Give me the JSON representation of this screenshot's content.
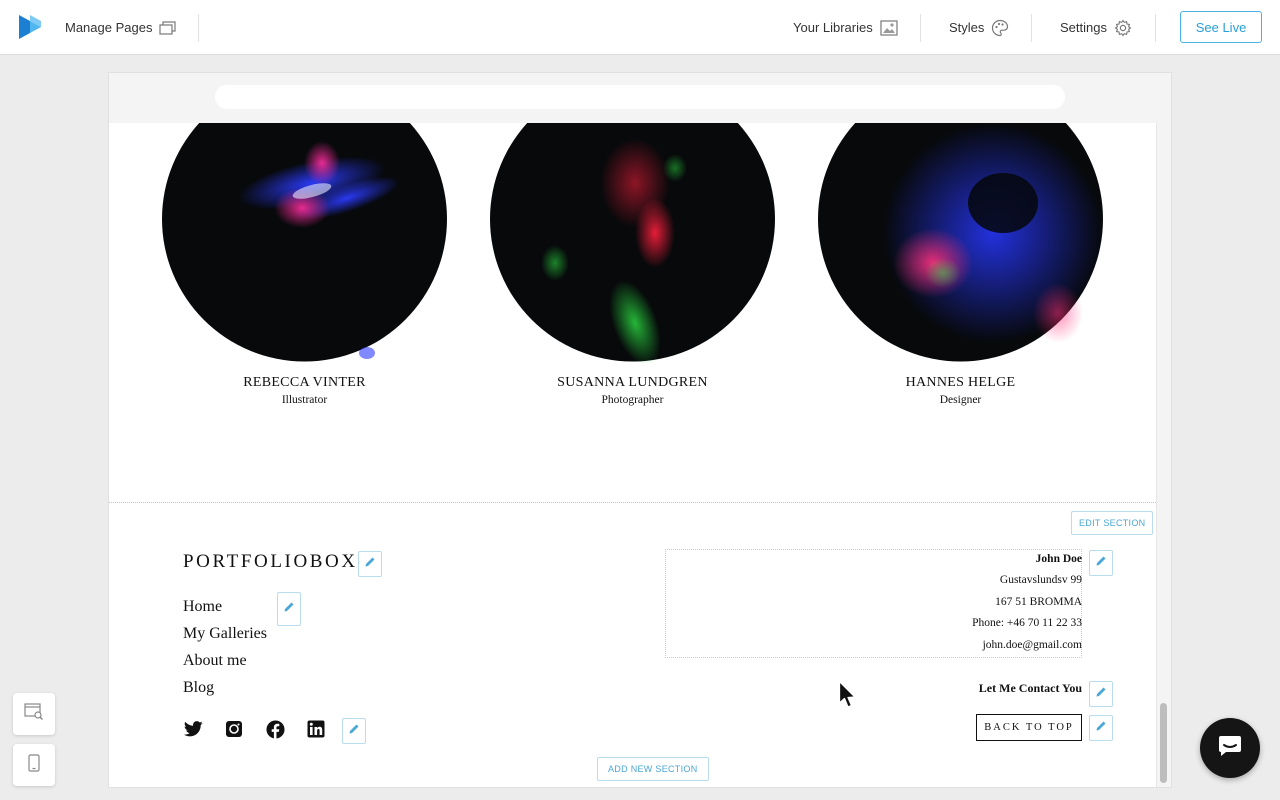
{
  "topbar": {
    "manage_pages": "Manage Pages",
    "your_libraries": "Your Libraries",
    "styles": "Styles",
    "settings": "Settings",
    "see_live": "See Live"
  },
  "team": [
    {
      "name": "REBECCA VINTER",
      "role": "Illustrator"
    },
    {
      "name": "SUSANNA LUNDGREN",
      "role": "Photographer"
    },
    {
      "name": "HANNES HELGE",
      "role": "Designer"
    }
  ],
  "footer": {
    "edit_section": "EDIT SECTION",
    "brand": "PORTFOLIOBOX",
    "nav": [
      "Home",
      "My Galleries",
      "About me",
      "Blog"
    ],
    "contact": {
      "name": "John Doe",
      "street": "Gustavslundsv 99",
      "city": "167 51 BROMMA",
      "phone": "Phone: +46 70 11 22 33",
      "email": "john.doe@gmail.com"
    },
    "let_me_contact": "Let Me Contact You",
    "back_to_top": "BACK TO TOP",
    "add_new_section": "ADD NEW SECTION"
  },
  "colors": {
    "accent": "#2a9fd8",
    "edit_outline": "#b9dcef"
  },
  "icons": [
    "pages-icon",
    "libraries-icon",
    "palette-icon",
    "gear-icon",
    "twitter-icon",
    "instagram-icon",
    "facebook-icon",
    "linkedin-icon",
    "pencil-icon",
    "preview-search-icon",
    "mobile-icon",
    "chat-icon"
  ]
}
